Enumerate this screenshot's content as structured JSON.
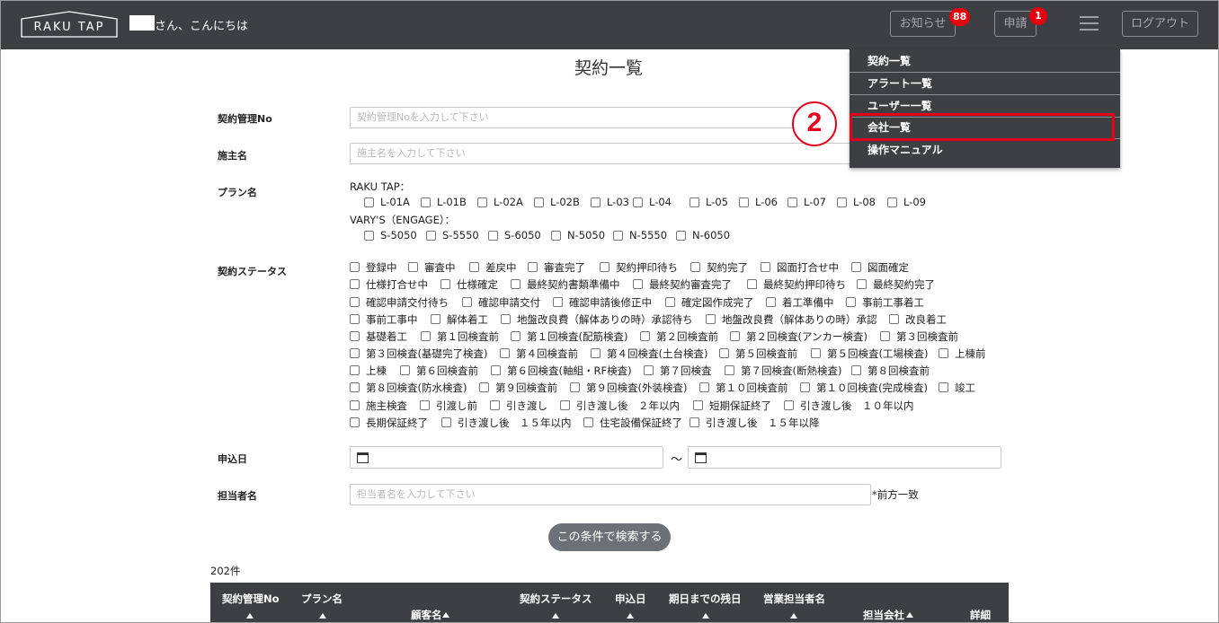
{
  "header": {
    "logo": "RAKU TAP",
    "greeting": "さん、こんにちは",
    "notice_label": "お知らせ",
    "notice_count": "88",
    "apply_label": "申請",
    "apply_count": "1",
    "logout_label": "ログアウト"
  },
  "menu": {
    "items": [
      "契約一覧",
      "アラート一覧",
      "ユーザー一覧",
      "会社一覧",
      "操作マニュアル"
    ],
    "step_number": "2",
    "highlight_color": "#e4001b"
  },
  "page": {
    "title": "契約一覧"
  },
  "form": {
    "contract_no": {
      "label": "契約管理No",
      "placeholder": "契約管理Noを入力して下さい"
    },
    "owner": {
      "label": "施主名",
      "placeholder": "施主名を入力して下さい"
    },
    "plan": {
      "label": "プラン名",
      "raku_label": "RAKU TAP：",
      "raku_options": [
        "L-01A",
        "L-01B",
        "L-02A",
        "L-02B",
        "L-03",
        "L-04",
        "L-05",
        "L-06",
        "L-07",
        "L-08",
        "L-09"
      ],
      "vary_label": "VARY'S（ENGAGE）：",
      "vary_options": [
        "S-5050",
        "S-5550",
        "S-6050",
        "N-5050",
        "N-5550",
        "N-6050"
      ]
    },
    "status": {
      "label": "契約ステータス",
      "rows": [
        [
          "登録中",
          "審査中",
          "差戻中",
          "審査完了",
          "契約押印待ち",
          "契約完了",
          "図面打合せ中",
          "図面確定"
        ],
        [
          "仕様打合せ中",
          "仕様確定",
          "最終契約書類準備中",
          "最終契約審査完了",
          "最終契約押印待ち",
          "最終契約完了"
        ],
        [
          "確認申請交付待ち",
          "確認申請交付",
          "確認申請後修正中",
          "確定図作成完了",
          "着工準備中",
          "事前工事着工"
        ],
        [
          "事前工事中",
          "解体着工",
          "地盤改良費（解体ありの時）承認待ち",
          "地盤改良費（解体ありの時）承認",
          "改良着工"
        ],
        [
          "基礎着工",
          "第１回検査前",
          "第１回検査(配筋検査)",
          "第２回検査前",
          "第２回検査(アンカー検査)",
          "第３回検査前"
        ],
        [
          "第３回検査(基礎完了検査)",
          "第４回検査前",
          "第４回検査(土台検査)",
          "第５回検査前",
          "第５回検査(工場検査)",
          "上棟前"
        ],
        [
          "上棟",
          "第６回検査前",
          "第６回検査(軸組・RF検査)",
          "第７回検査",
          "第７回検査(断熱検査)",
          "第８回検査前"
        ],
        [
          "第８回検査(防水検査)",
          "第９回検査前",
          "第９回検査(外装検査)",
          "第１０回検査前",
          "第１０回検査(完成検査)",
          "竣工"
        ],
        [
          "施主検査",
          "引渡し前",
          "引き渡し",
          "引き渡し後　２年以内",
          "短期保証終了",
          "引き渡し後　１０年以内"
        ],
        [
          "長期保証終了",
          "引き渡し後　１５年以内",
          "住宅設備保証終了",
          "引き渡し後　１５年以降"
        ]
      ]
    },
    "apply_date": {
      "label": "申込日",
      "separator": "～"
    },
    "staff": {
      "label": "担当者名",
      "placeholder": "担当者名を入力して下さい",
      "note": "*前方一致"
    },
    "search_button": "この条件で検索する"
  },
  "results": {
    "count": "202件",
    "columns": [
      "契約管理No",
      "プラン名",
      "顧客名",
      "契約ステータス",
      "申込日",
      "期日までの残日",
      "営業担当者名",
      "担当会社",
      "詳細"
    ]
  }
}
